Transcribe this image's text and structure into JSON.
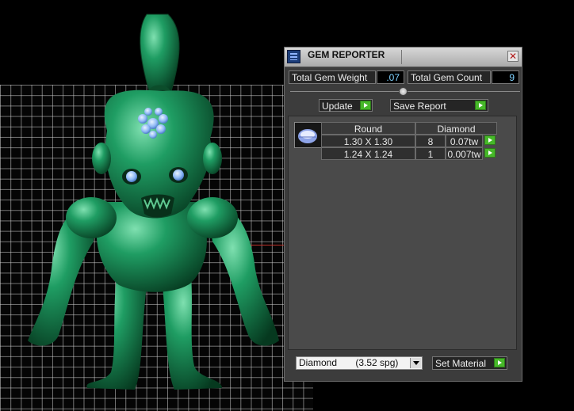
{
  "panel": {
    "title": "GEM REPORTER",
    "close_glyph": "✕",
    "icons": {
      "app": "gem-reporter-app-icon",
      "close": "close-icon"
    }
  },
  "stats": {
    "total_weight_label": "Total Gem Weight",
    "total_weight_value": ".07",
    "total_count_label": "Total Gem Count",
    "total_count_value": "9"
  },
  "actions": {
    "update_label": "Update",
    "save_report_label": "Save Report"
  },
  "gem_table": {
    "shape_header": "Round",
    "material_header": "Diamond",
    "rows": [
      {
        "size": "1.30 X 1.30",
        "count": "8",
        "weight": "0.07tw"
      },
      {
        "size": "1.24 X 1.24",
        "count": "1",
        "weight": "0.007tw"
      }
    ]
  },
  "material": {
    "selected": "Diamond       (3.52 spg)",
    "set_material_label": "Set Material"
  },
  "colors": {
    "panel_bg": "#3c3c3c",
    "value_text": "#7fd2ff",
    "go_button": "#46b829",
    "model_green": "#1f8f5c",
    "gem_blue": "#9cc8ff",
    "axis_red": "#c0302a"
  }
}
